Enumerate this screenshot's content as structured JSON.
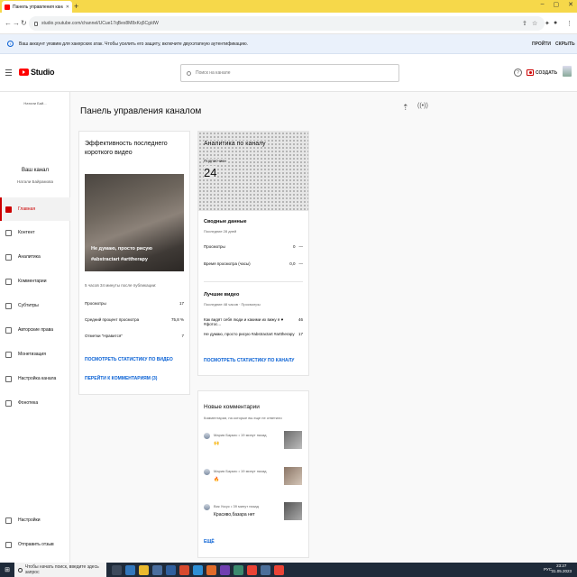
{
  "browser": {
    "tab_title": "Панель управления каналом",
    "url": "studio.youtube.com/channel/UCue17qBex8M8xKq5Cg/dW",
    "infobar_text": "Ваш аккаунт уязвим для хакерских атак. Чтобы усилить его защиту, включите двухэтапную аутентификацию.",
    "infobar_action_primary": "ПРОЙТИ",
    "infobar_action_secondary": "СКРЫТЬ"
  },
  "header": {
    "logo_text": "Studio",
    "search_placeholder": "Поиск на канале",
    "create_label": "СОЗДАТЬ"
  },
  "sidebar": {
    "channel_logo_text": "Натали Бай...",
    "channel_name": "Ваш канал",
    "channel_owner": "Натали Байрамова",
    "items": [
      {
        "label": "Главная",
        "icon": "dashboard-icon"
      },
      {
        "label": "Контент",
        "icon": "content-icon"
      },
      {
        "label": "Аналитика",
        "icon": "analytics-icon"
      },
      {
        "label": "Комментарии",
        "icon": "comments-icon"
      },
      {
        "label": "Субтитры",
        "icon": "subtitles-icon"
      },
      {
        "label": "Авторские права",
        "icon": "copyright-icon"
      },
      {
        "label": "Монетизация",
        "icon": "monetization-icon"
      },
      {
        "label": "Настройка канала",
        "icon": "customization-icon"
      },
      {
        "label": "Фонотека",
        "icon": "audio-library-icon"
      }
    ],
    "bottom_items": [
      {
        "label": "Настройки",
        "icon": "settings-icon"
      },
      {
        "label": "Отправить отзыв",
        "icon": "feedback-icon"
      }
    ]
  },
  "main": {
    "title": "Панель управления каналом",
    "short_card": {
      "title": "Эффективность последнего короткого видео",
      "thumb_caption": "Не думаю, просто рисую #abstractart #arttherapy",
      "published": "5 часов 34 минуты после публикации:",
      "stats": [
        {
          "label": "Просмотры",
          "value": "17"
        },
        {
          "label": "Средний процент просмотра",
          "value": "75,8 %"
        },
        {
          "label": "Отметки \"Нравится\"",
          "value": "7"
        }
      ],
      "link_stats": "ПОСМОТРЕТЬ СТАТИСТИКУ ПО ВИДЕО",
      "link_comments": "ПЕРЕЙТИ К КОММЕНТАРИЯМ (3)"
    },
    "analytics_card": {
      "title": "Аналитика по каналу",
      "subs_label": "Подписчики",
      "subs_value": "24",
      "summary_title": "Сводные данные",
      "summary_period": "Последние 28 дней",
      "summary_rows": [
        {
          "label": "Просмотры",
          "value": "0",
          "delta": "—"
        },
        {
          "label": "Время просмотра (часы)",
          "value": "0,0",
          "delta": "—"
        }
      ],
      "top_title": "Лучшие видео",
      "top_period": "Последние 48 часов · Просмотры",
      "top_rows": [
        {
          "label": "Как видят себя люди и какими их вижу я ♥ #фотос...",
          "value": "46"
        },
        {
          "label": "Не думаю, просто рисую #abstractart #arttherapy",
          "value": "17"
        }
      ],
      "link": "ПОСМОТРЕТЬ СТАТИСТИКУ ПО КАНАЛУ"
    },
    "comments_card": {
      "title": "Новые комментарии",
      "subtitle": "Комментарии, на которые вы еще не ответили",
      "comments": [
        {
          "meta": "Мария Баркис • 19 минут назад",
          "text": "🙌"
        },
        {
          "meta": "Мария Баркис • 19 минут назад",
          "text": "🔥"
        },
        {
          "meta": "Вик Уксус • 39 минут назад",
          "text": "Красиво,базара нет"
        }
      ],
      "more_label": "ЕЩЁ"
    }
  },
  "taskbar": {
    "search_placeholder": "Чтобы начать поиск, введите здесь запрос",
    "lang": "РУС",
    "time": "23:27",
    "date": "31.05.2023"
  },
  "colors": {
    "accent_red": "#cc0000",
    "link_blue": "#065fd4",
    "tabbar_yellow": "#f6d84a"
  }
}
